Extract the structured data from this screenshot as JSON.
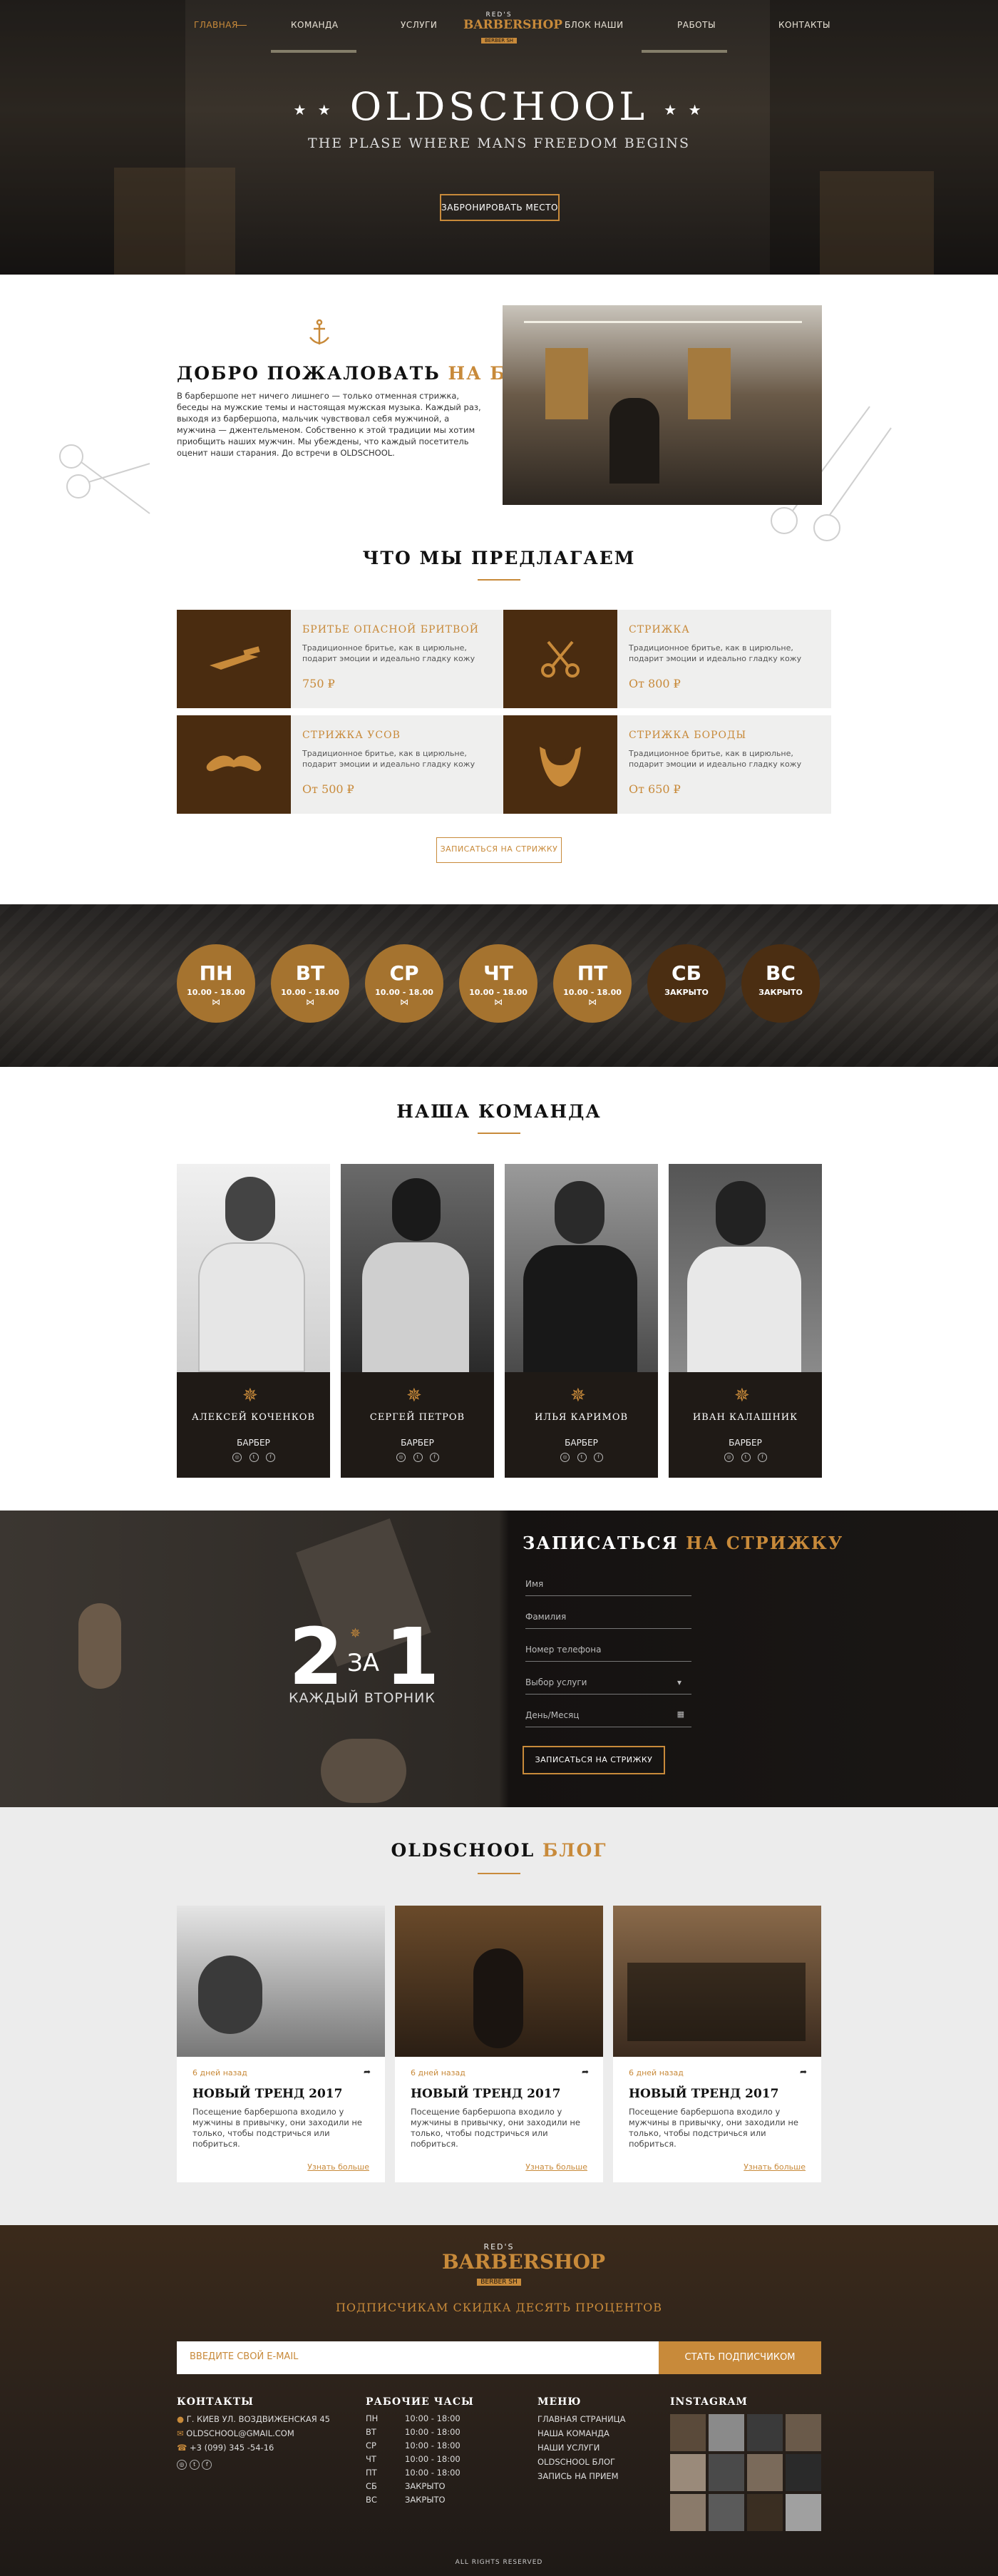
{
  "nav": {
    "items": [
      "ГЛАВНАЯ",
      "КОМАНДА",
      "УСЛУГИ",
      "БЛОК НАШИ",
      "РАБОТЫ",
      "КОНТАКТЫ"
    ],
    "logo_top": "RED'S",
    "logo_main": "BARBERSHOP",
    "logo_bottom": "BERBER SH"
  },
  "hero": {
    "title": "OLDSCHOOL",
    "subtitle": "THE PLASE WHERE MANS FREEDOM BEGINS",
    "button": "ЗАБРОНИРОВАТЬ МЕСТО"
  },
  "welcome": {
    "title_a": "ДОБРО ПОЖАЛОВАТЬ",
    "title_b": "НА БОРТ",
    "text": "В барбершопе нет ничего лишнего — только отменная стрижка, беседы на мужские темы и настоящая мужская музыка. Каждый раз, выходя из барбершопа, мальчик чувствовал себя мужчиной, а мужчина — джентельменом. Собственно к этой традиции мы хотим приобщить наших мужчин. Мы убеждены, что каждый посетитель оценит наши старания. До встречи в OLDSCHOOL."
  },
  "services": {
    "title": "ЧТО МЫ ПРЕДЛАГАЕМ",
    "items": [
      {
        "name": "БРИТЬЕ ОПАСНОЙ БРИТВОЙ",
        "desc": "Традиционное бритье, как в цирюльне, подарит эмоции и идеально гладку кожу",
        "price": "750 ₽",
        "icon": "razor-icon"
      },
      {
        "name": "СТРИЖКА",
        "desc": "Традиционное бритье, как в цирюльне, подарит эмоции и идеально гладку кожу",
        "price": "От 800 ₽",
        "icon": "scissors-icon"
      },
      {
        "name": "СТРИЖКА УСОВ",
        "desc": "Традиционное бритье, как в цирюльне, подарит эмоции и идеально гладку кожу",
        "price": "От 500 ₽",
        "icon": "mustache-icon"
      },
      {
        "name": "СТРИЖКА БОРОДЫ",
        "desc": "Традиционное бритье, как в цирюльне, подарит эмоции и идеально гладку кожу",
        "price": "От 650 ₽",
        "icon": "beard-icon"
      }
    ],
    "button": "ЗАПИСАТЬСЯ НА СТРИЖКУ"
  },
  "schedule": [
    {
      "day": "ПН",
      "hours": "10.00 - 18.00"
    },
    {
      "day": "ВТ",
      "hours": "10.00 - 18.00"
    },
    {
      "day": "СР",
      "hours": "10.00 - 18.00"
    },
    {
      "day": "ЧТ",
      "hours": "10.00 - 18.00"
    },
    {
      "day": "ПТ",
      "hours": "10.00 - 18.00"
    },
    {
      "day": "СБ",
      "hours": "ЗАКРЫТО"
    },
    {
      "day": "ВС",
      "hours": "ЗАКРЫТО"
    }
  ],
  "team": {
    "title": "НАША КОМАНДА",
    "members": [
      {
        "name": "АЛЕКСЕЙ КОЧЕНКОВ",
        "role": "БАРБЕР"
      },
      {
        "name": "СЕРГЕЙ ПЕТРОВ",
        "role": "БАРБЕР"
      },
      {
        "name": "ИЛЬЯ КАРИМОВ",
        "role": "БАРБЕР"
      },
      {
        "name": "ИВАН КАЛАШНИК",
        "role": "БАРБЕР"
      }
    ]
  },
  "booking": {
    "title_a": "ЗАПИСАТЬСЯ",
    "title_b": "НА СТРИЖКУ",
    "promo_big_a": "2",
    "promo_mid": "ЗА",
    "promo_big_b": "1",
    "promo_sub": "КАЖДЫЙ ВТОРНИК",
    "fields": [
      "Имя",
      "Фамилия",
      "Номер телефона",
      "Выбор услуги",
      "День/Месяц"
    ],
    "button": "ЗАПИСАТЬСЯ НА СТРИЖКУ"
  },
  "blog": {
    "title_a": "OLDSCHOOL",
    "title_b": "БЛОГ",
    "posts": [
      {
        "date": "6 дней назад",
        "title": "НОВЫЙ ТРЕНД 2017",
        "text": "Посещение барбершопа входило у мужчины в привычку, они заходили не только, чтобы подстричься или побриться.",
        "more": "Узнать больше"
      },
      {
        "date": "6 дней назад",
        "title": "НОВЫЙ ТРЕНД 2017",
        "text": "Посещение барбершопа входило у мужчины в привычку, они заходили не только, чтобы подстричься или побриться.",
        "more": "Узнать больше"
      },
      {
        "date": "6 дней назад",
        "title": "НОВЫЙ ТРЕНД 2017",
        "text": "Посещение барбершопа входило у мужчины в привычку, они заходили не только, чтобы подстричься или побриться.",
        "more": "Узнать больше"
      }
    ]
  },
  "footer": {
    "promo": "ПОДПИСЧИКАМ СКИДКА ДЕСЯТЬ ПРОЦЕНТОВ",
    "email_placeholder": "ВВЕДИТЕ СВОЙ E-MAIL",
    "subscribe": "СТАТЬ ПОДПИСЧИКОМ",
    "contacts_title": "КОНТАКТЫ",
    "address": "Г. КИЕВ УЛ. ВОЗДВИЖЕНСКАЯ 45",
    "email": "OLDSCHOOL@GMAIL.COM",
    "phone": "+3 (099) 345 -54-16",
    "hours_title": "РАБОЧИЕ ЧАСЫ",
    "hours": [
      {
        "d": "ПН",
        "h": "10:00 - 18:00"
      },
      {
        "d": "ВТ",
        "h": "10:00 - 18:00"
      },
      {
        "d": "СР",
        "h": "10:00 - 18:00"
      },
      {
        "d": "ЧТ",
        "h": "10:00 - 18:00"
      },
      {
        "d": "ПТ",
        "h": "10:00 - 18:00"
      },
      {
        "d": "СБ",
        "h": "ЗАКРЫТО"
      },
      {
        "d": "ВС",
        "h": "ЗАКРЫТО"
      }
    ],
    "menu_title": "МЕНЮ",
    "menu": [
      "ГЛАВНАЯ СТРАНИЦА",
      "НАША КОМАНДА",
      "НАШИ УСЛУГИ",
      "OLDSCHOOL БЛОГ",
      "ЗАПИСЬ НА ПРИЕМ"
    ],
    "instagram_title": "INSTAGRAM",
    "copyright": "ALL RIGHTS RESERVED"
  },
  "colors": {
    "accent": "#c88a3a",
    "dark_brown": "#4a2c10",
    "gold_circle": "#a5732f"
  }
}
